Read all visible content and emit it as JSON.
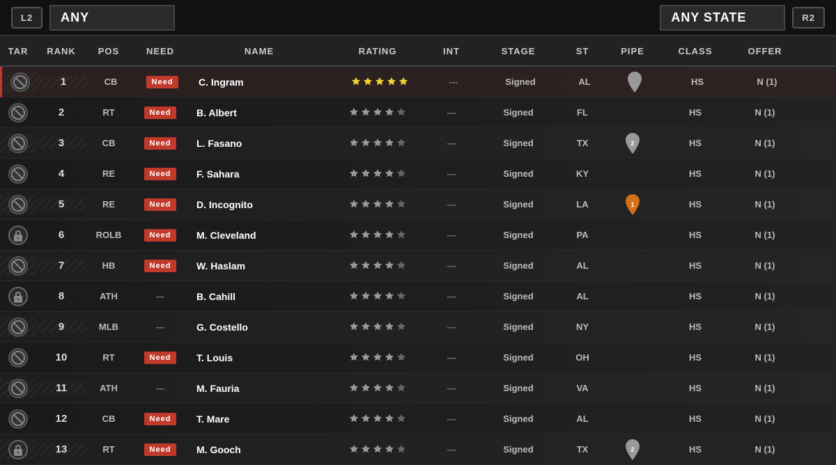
{
  "topBar": {
    "leftTrigger": "L2",
    "leftFilter": "ANY",
    "rightFilter": "ANY STATE",
    "rightTrigger": "R2"
  },
  "columns": [
    "TAR",
    "RANK",
    "POS",
    "NEED",
    "NAME",
    "RATING",
    "INT",
    "STAGE",
    "ST",
    "PIPE",
    "CLASS",
    "OFFER"
  ],
  "rows": [
    {
      "rank": "1",
      "pos": "CB",
      "need": "Need",
      "name": "C. Ingram",
      "rating": 5,
      "ratingType": "gold",
      "int": "---",
      "stage": "Signed",
      "st": "AL",
      "pipe": "pin-grey",
      "pipeNum": "",
      "class": "HS",
      "offer": "N (1)",
      "tar": "block",
      "isFirst": true
    },
    {
      "rank": "2",
      "pos": "RT",
      "need": "Need",
      "name": "B. Albert",
      "rating": 4,
      "ratingType": "grey",
      "int": "---",
      "stage": "Signed",
      "st": "FL",
      "pipe": "",
      "pipeNum": "",
      "class": "HS",
      "offer": "N (1)",
      "tar": "block",
      "isFirst": false
    },
    {
      "rank": "3",
      "pos": "CB",
      "need": "Need",
      "name": "L. Fasano",
      "rating": 4,
      "ratingType": "grey",
      "int": "---",
      "stage": "Signed",
      "st": "TX",
      "pipe": "pin-grey",
      "pipeNum": "2",
      "class": "HS",
      "offer": "N (1)",
      "tar": "block",
      "isFirst": false
    },
    {
      "rank": "4",
      "pos": "RE",
      "need": "Need",
      "name": "F. Sahara",
      "rating": 4,
      "ratingType": "grey",
      "int": "---",
      "stage": "Signed",
      "st": "KY",
      "pipe": "",
      "pipeNum": "",
      "class": "HS",
      "offer": "N (1)",
      "tar": "block",
      "isFirst": false
    },
    {
      "rank": "5",
      "pos": "RE",
      "need": "Need",
      "name": "D. Incognito",
      "rating": 4,
      "ratingType": "grey",
      "int": "---",
      "stage": "Signed",
      "st": "LA",
      "pipe": "pin-orange",
      "pipeNum": "1",
      "class": "HS",
      "offer": "N (1)",
      "tar": "block",
      "isFirst": false
    },
    {
      "rank": "6",
      "pos": "ROLB",
      "need": "Need",
      "name": "M. Cleveland",
      "rating": 4,
      "ratingType": "grey",
      "int": "---",
      "stage": "Signed",
      "st": "PA",
      "pipe": "",
      "pipeNum": "",
      "class": "HS",
      "offer": "N (1)",
      "tar": "lock",
      "isFirst": false
    },
    {
      "rank": "7",
      "pos": "HB",
      "need": "Need",
      "name": "W. Haslam",
      "rating": 4,
      "ratingType": "grey",
      "int": "---",
      "stage": "Signed",
      "st": "AL",
      "pipe": "",
      "pipeNum": "",
      "class": "HS",
      "offer": "N (1)",
      "tar": "block",
      "isFirst": false
    },
    {
      "rank": "8",
      "pos": "ATH",
      "need": "---",
      "name": "B. Cahill",
      "rating": 4,
      "ratingType": "grey",
      "int": "---",
      "stage": "Signed",
      "st": "AL",
      "pipe": "",
      "pipeNum": "",
      "class": "HS",
      "offer": "N (1)",
      "tar": "lock",
      "isFirst": false
    },
    {
      "rank": "9",
      "pos": "MLB",
      "need": "---",
      "name": "G. Costello",
      "rating": 4,
      "ratingType": "grey",
      "int": "---",
      "stage": "Signed",
      "st": "NY",
      "pipe": "",
      "pipeNum": "",
      "class": "HS",
      "offer": "N (1)",
      "tar": "block",
      "isFirst": false
    },
    {
      "rank": "10",
      "pos": "RT",
      "need": "Need",
      "name": "T. Louis",
      "rating": 4,
      "ratingType": "grey",
      "int": "---",
      "stage": "Signed",
      "st": "OH",
      "pipe": "",
      "pipeNum": "",
      "class": "HS",
      "offer": "N (1)",
      "tar": "block",
      "isFirst": false
    },
    {
      "rank": "11",
      "pos": "ATH",
      "need": "---",
      "name": "M. Fauria",
      "rating": 4,
      "ratingType": "grey",
      "int": "---",
      "stage": "Signed",
      "st": "VA",
      "pipe": "",
      "pipeNum": "",
      "class": "HS",
      "offer": "N (1)",
      "tar": "block",
      "isFirst": false
    },
    {
      "rank": "12",
      "pos": "CB",
      "need": "Need",
      "name": "T. Mare",
      "rating": 4,
      "ratingType": "grey",
      "int": "---",
      "stage": "Signed",
      "st": "AL",
      "pipe": "",
      "pipeNum": "",
      "class": "HS",
      "offer": "N (1)",
      "tar": "block",
      "isFirst": false
    },
    {
      "rank": "13",
      "pos": "RT",
      "need": "Need",
      "name": "M. Gooch",
      "rating": 4,
      "ratingType": "grey",
      "int": "---",
      "stage": "Signed",
      "st": "TX",
      "pipe": "pin-grey",
      "pipeNum": "2",
      "class": "HS",
      "offer": "N (1)",
      "tar": "lock",
      "isFirst": false
    }
  ]
}
